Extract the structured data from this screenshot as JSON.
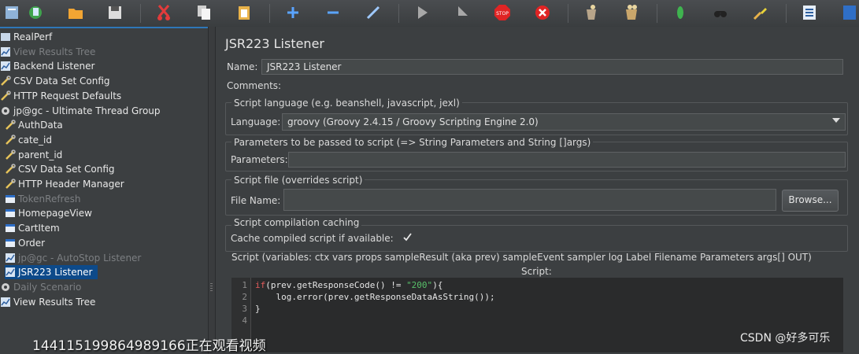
{
  "tree": {
    "items": [
      {
        "label": "RealPerf",
        "icon": "test-plan-icon",
        "enabled": true
      },
      {
        "label": "View Results Tree",
        "icon": "listener-icon",
        "enabled": false
      },
      {
        "label": "Backend Listener",
        "icon": "listener-icon",
        "enabled": true
      },
      {
        "label": "CSV Data Set Config",
        "icon": "config-wrench-icon",
        "enabled": true
      },
      {
        "label": "HTTP Request Defaults",
        "icon": "config-wrench-icon",
        "enabled": true
      },
      {
        "label": "jp@gc - Ultimate Thread Group",
        "icon": "thread-group-gear-icon",
        "enabled": true
      },
      {
        "label": "AuthData",
        "icon": "config-wrench-icon",
        "enabled": true
      },
      {
        "label": "cate_id",
        "icon": "config-wrench-icon",
        "enabled": true
      },
      {
        "label": "parent_id",
        "icon": "config-wrench-icon",
        "enabled": true
      },
      {
        "label": "CSV Data Set Config",
        "icon": "config-wrench-icon",
        "enabled": true
      },
      {
        "label": "HTTP Header Manager",
        "icon": "config-wrench-icon",
        "enabled": true
      },
      {
        "label": "TokenRefresh",
        "icon": "sampler-icon",
        "enabled": false
      },
      {
        "label": "HomepageView",
        "icon": "sampler-icon",
        "enabled": true
      },
      {
        "label": "CartItem",
        "icon": "sampler-icon",
        "enabled": true
      },
      {
        "label": "Order",
        "icon": "sampler-icon",
        "enabled": true
      },
      {
        "label": "jp@gc - AutoStop Listener",
        "icon": "listener-icon",
        "enabled": false
      },
      {
        "label": "JSR223 Listener",
        "icon": "listener-icon",
        "enabled": true,
        "selected": true
      },
      {
        "label": "Daily Scenario",
        "icon": "thread-group-gear-icon",
        "enabled": false
      },
      {
        "label": "View Results Tree",
        "icon": "listener-icon",
        "enabled": true
      }
    ]
  },
  "panel": {
    "title": "JSR223 Listener",
    "name_label": "Name:",
    "name_value": "JSR223 Listener",
    "comments_label": "Comments:",
    "language_group": "Script language (e.g. beanshell, javascript, jexl)",
    "language_label": "Language:",
    "language_value": "groovy     (Groovy 2.4.15 / Groovy Scripting Engine 2.0)",
    "params_group": "Parameters to be passed to script (=> String Parameters and String []args)",
    "params_label": "Parameters:",
    "params_value": "",
    "file_group": "Script file (overrides script)",
    "file_label": "File Name:",
    "file_value": "",
    "browse_label": "Browse...",
    "cache_group": "Script compilation caching",
    "cache_label": "Cache compiled script if available:",
    "cache_checked": true,
    "script_group": "Script (variables: ctx vars props sampleResult (aka prev) sampleEvent sampler log Label Filename Parameters args[] OUT)",
    "script_header": "Script:",
    "line_numbers": [
      "1",
      "2",
      "3",
      "4"
    ],
    "code": {
      "l1_kw": "if",
      "l1_a": "(prev.getResponseCode() != ",
      "l1_str": "\"200\"",
      "l1_b": "){",
      "l2": "    log.error(prev.getResponseDataAsString());",
      "l3": "}"
    }
  },
  "overlay": {
    "left_text": "1441151998649891​66正在观看视频",
    "right_text": "CSDN @好多可乐"
  },
  "colors": {
    "selection": "#0d4a8a",
    "accent": "#2e77b8",
    "keyword": "#e15b5b",
    "string": "#58c06a"
  }
}
